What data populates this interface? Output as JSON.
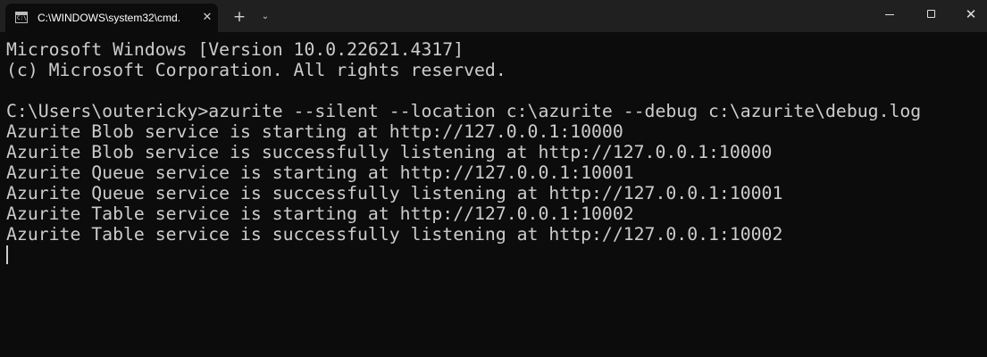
{
  "tab": {
    "title": "C:\\WINDOWS\\system32\\cmd.",
    "icon": "cmd-icon",
    "icon_glyph": "C:\\",
    "close": "✕"
  },
  "tabbar": {
    "new_tab": "+",
    "dropdown": "⌄"
  },
  "window_controls": {
    "close": "✕"
  },
  "console": {
    "lines": [
      "Microsoft Windows [Version 10.0.22621.4317]",
      "(c) Microsoft Corporation. All rights reserved.",
      "",
      "C:\\Users\\outericky>azurite --silent --location c:\\azurite --debug c:\\azurite\\debug.log",
      "Azurite Blob service is starting at http://127.0.0.1:10000",
      "Azurite Blob service is successfully listening at http://127.0.0.1:10000",
      "Azurite Queue service is starting at http://127.0.0.1:10001",
      "Azurite Queue service is successfully listening at http://127.0.0.1:10001",
      "Azurite Table service is starting at http://127.0.0.1:10002",
      "Azurite Table service is successfully listening at http://127.0.0.1:10002"
    ]
  },
  "colors": {
    "background": "#0c0c0c",
    "titlebar": "#202020",
    "text": "#cccccc"
  }
}
